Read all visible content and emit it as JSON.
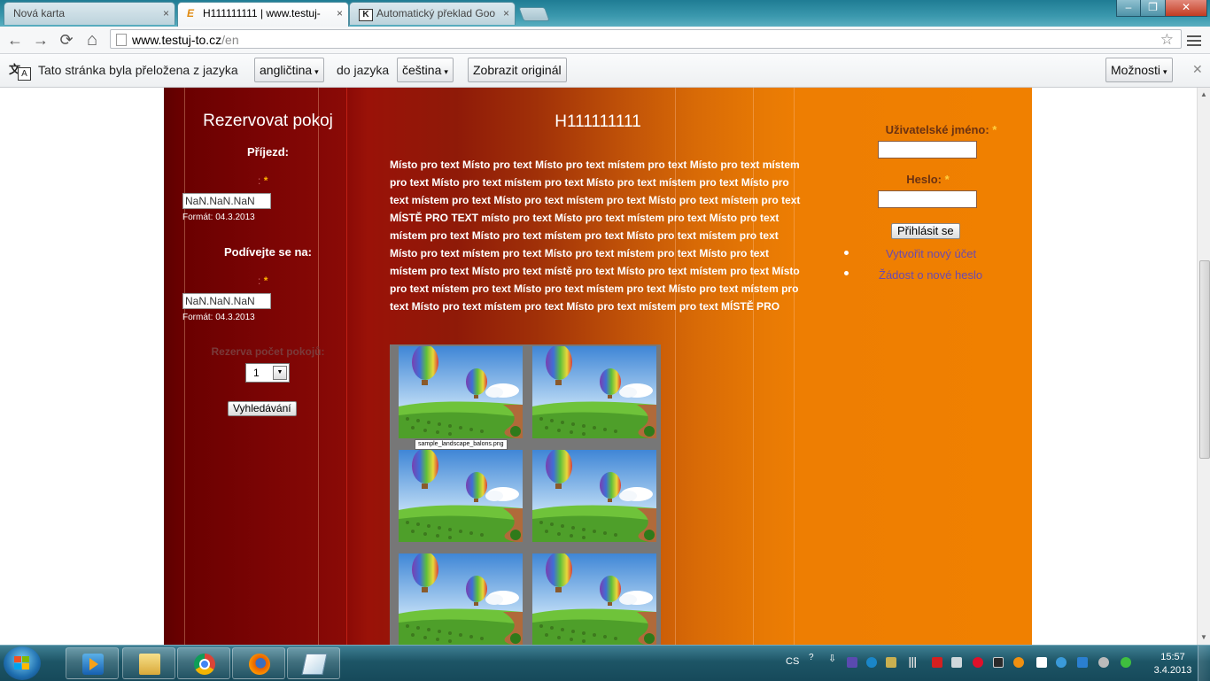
{
  "tabs": [
    {
      "title": "Nová karta",
      "close": "×"
    },
    {
      "title": "H111111111 | www.testuj-",
      "close": "×",
      "icon_letter": "E"
    },
    {
      "title": "Automatický překlad Goo",
      "close": "×",
      "icon_letter": "K"
    }
  ],
  "window": {
    "minimize": "–",
    "maximize": "❐",
    "close": "✕"
  },
  "toolbar": {
    "back": "←",
    "forward": "→",
    "reload": "⟳",
    "home": "⌂",
    "url_host": "www.testuj-to.cz",
    "url_path": "/en",
    "star": "☆"
  },
  "translate_bar": {
    "message": "Tato stránka byla přeložena z jazyka",
    "from_lang": "angličtina",
    "to_label": "do jazyka",
    "to_lang": "čeština",
    "show_original": "Zobrazit originál",
    "options": "Možnosti",
    "close": "✕",
    "caret": "▾"
  },
  "left": {
    "title": "Rezervovat pokoj",
    "arrival_label": "Příjezd:",
    "arrival_req_colon": ":",
    "arrival_req_star": "*",
    "arrival_value": "NaN.NaN.NaN",
    "arrival_format": "Formát: 04.3.2013",
    "view_label": "Podívejte se na:",
    "view_req_colon": ":",
    "view_req_star": "*",
    "view_value": "NaN.NaN.NaN",
    "view_format": "Formát: 04.3.2013",
    "rooms_label": "Rezerva počet pokojů:",
    "rooms_value": "1",
    "rooms_arrow": "▼",
    "search_button": "Vyhledávání"
  },
  "main": {
    "title": "H111111111",
    "body_text": "Místo pro text Místo pro text Místo pro text místem pro text Místo pro text místem pro text Místo pro text místem pro text Místo pro text místem pro text Místo pro text místem pro text Místo pro text místem pro text Místo pro text místem pro text MÍSTĚ PRO TEXT místo pro text Místo pro text místem pro text Místo pro text místem pro text Místo pro text místem pro text Místo pro text místem pro text Místo pro text místem pro text Místo pro text místem pro text Místo pro text místem pro text Místo pro text místě pro text Místo pro text místem pro text Místo pro text místem pro text Místo pro text místem pro text Místo pro text místem pro text Místo pro text místem pro text Místo pro text místem pro text MÍSTĚ PRO",
    "gallery_tooltip": "sample_landscape_balons.png",
    "gallery_count": 6
  },
  "right": {
    "username_label": "Uživatelské jméno:",
    "password_label": "Heslo:",
    "required_star": "*",
    "login_button": "Přihlásit se",
    "create_account": "Vytvořit nový účet",
    "new_password": "Žádost o nové heslo"
  },
  "taskbar": {
    "lang": "CS",
    "time": "15:57",
    "date": "3.4.2013",
    "apps": [
      "media-player-icon",
      "file-explorer-icon",
      "chrome-icon",
      "firefox-icon",
      "notepad-icon"
    ]
  }
}
